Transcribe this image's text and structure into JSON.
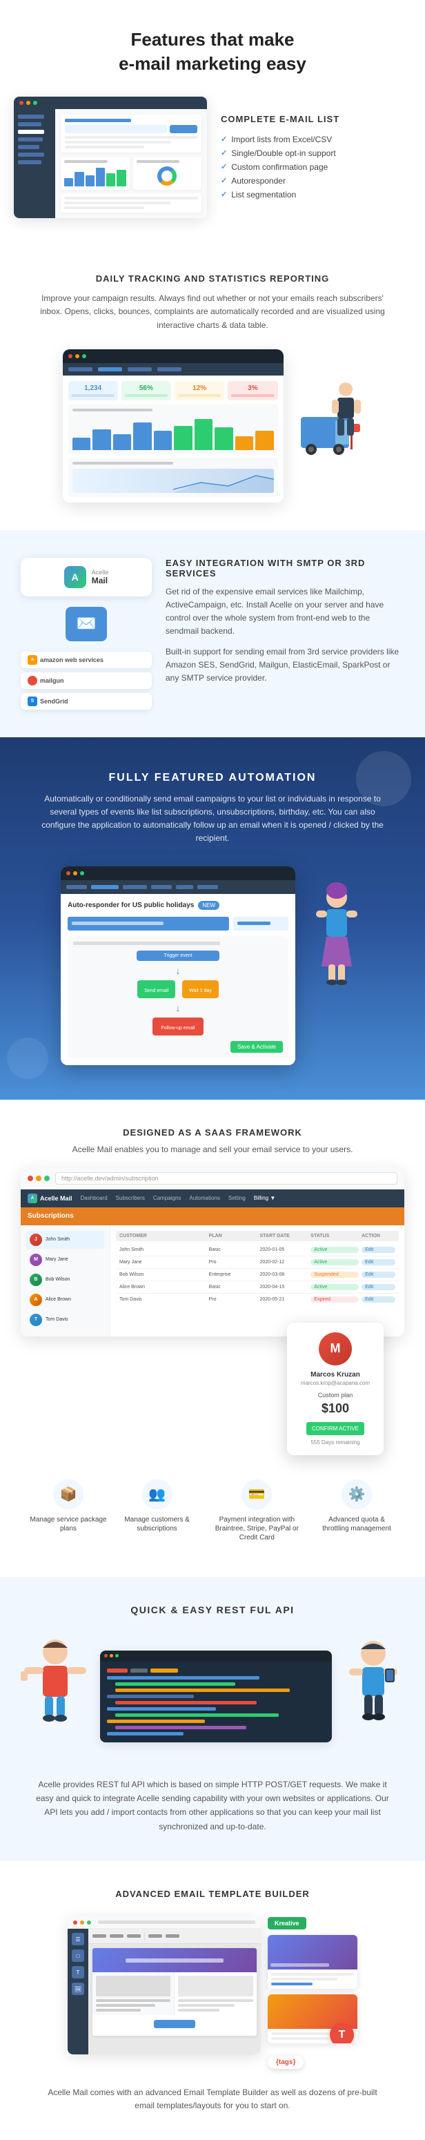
{
  "header": {
    "title_line1": "Features that make",
    "title_line2": "e-mail marketing easy"
  },
  "email_list_section": {
    "title": "COMPLETE E-MAIL LIST",
    "features": [
      "Import lists from Excel/CSV",
      "Single/Double opt-in support",
      "Custom confirmation page",
      "Autoresponder",
      "List segmentation"
    ]
  },
  "tracking_section": {
    "title": "DAILY TRACKING AND STATISTICS REPORTING",
    "description": "Improve your campaign results. Always find out whether or not your emails reach subscribers' inbox. Opens, clicks, bounces, complaints are automatically recorded and are visualized using interactive charts & data table."
  },
  "smtp_section": {
    "title": "EASY INTEGRATION WITH SMTP OR 3RD SERVICES",
    "desc1": "Get rid of the expensive email services like Mailchimp, ActiveCampaign, etc. Install Acelle on your server and have control over the whole system from front-end web to the sendmail backend.",
    "desc2": "Built-in support for sending email from 3rd service providers like Amazon SES, SendGrid, Mailgun, ElasticEmail, SparkPost or any SMTP service provider.",
    "providers": [
      "amazon web services",
      "mailgun",
      "SendGrid"
    ],
    "logo_text": "Acelle Mail"
  },
  "automation_section": {
    "title": "FULLY FEATURED AUTOMATION",
    "description": "Automatically or conditionally send email campaigns to your list or individuals in response to several types of events like list subscriptions, unsubscriptions, birthday, etc. You can also configure the application to automatically follow up an email when it is opened / clicked by the recipient.",
    "mock_title": "Auto-responder for US public holidays",
    "mock_badge": "NEW"
  },
  "saas_section": {
    "title": "DESIGNED AS A SAAS FRAMEWORK",
    "description": "Acelle Mail enables you to manage and sell your email service to your users.",
    "url": "http://acelle.dev/admin/subscription",
    "nav_items": [
      "Dashboard",
      "Subscribers",
      "Campaigns",
      "Automations",
      "Setting",
      "Billing ▼"
    ],
    "orange_bar_title": "Subscriptions",
    "table_headers": [
      "Customer",
      "Plan",
      "Start Date",
      "Status",
      "Action"
    ],
    "table_rows": [
      [
        "John Smith",
        "Basic",
        "2020-01-05",
        "Active",
        "Edit"
      ],
      [
        "Mary Jane",
        "Pro",
        "2020-02-12",
        "Active",
        "Edit"
      ],
      [
        "Bob Wilson",
        "Enterprise",
        "2020-03-08",
        "Suspended",
        "Edit"
      ],
      [
        "Alice Brown",
        "Basic",
        "2020-04-15",
        "Active",
        "Edit"
      ],
      [
        "Tom Davis",
        "Pro",
        "2020-05-21",
        "Expired",
        "Edit"
      ]
    ],
    "user_card": {
      "name": "Marcos Kruzan",
      "email": "marcos.krop@acapana.com",
      "plan": "Custom plan",
      "price": "$100",
      "days": "555 Days remaining",
      "btn": "CONFIRM ACTIVE"
    },
    "features": [
      {
        "icon": "📦",
        "label": "Manage service package plans"
      },
      {
        "icon": "👥",
        "label": "Manage customers & subscriptions"
      },
      {
        "icon": "💳",
        "label": "Payment integration with Braintree, Stripe, PayPal or Credit Card"
      },
      {
        "icon": "⚙️",
        "label": "Advanced quota & throttling management"
      }
    ]
  },
  "api_section": {
    "title": "QUICK & EASY REST FUL API",
    "description": "Acelle provides REST ful API which is based on simple HTTP POST/GET requests. We make it easy and quick to integrate Acelle sending capability with your own websites or applications. Our API lets you add / import contacts from other applications so that you can keep your mail list synchronized and up-to-date."
  },
  "template_section": {
    "title": "ADVANCED EMAIL TEMPLATE BUILDER",
    "description": "Acelle Mail comes with an advanced Email Template Builder as well as dozens of pre-built email templates/layouts for you to start on.",
    "kreative_label": "Kreative"
  },
  "icons": {
    "check": "✓",
    "arrow": "→",
    "email": "✉",
    "settings": "⚙",
    "user": "👤",
    "chart": "📊",
    "t_letter": "T"
  }
}
